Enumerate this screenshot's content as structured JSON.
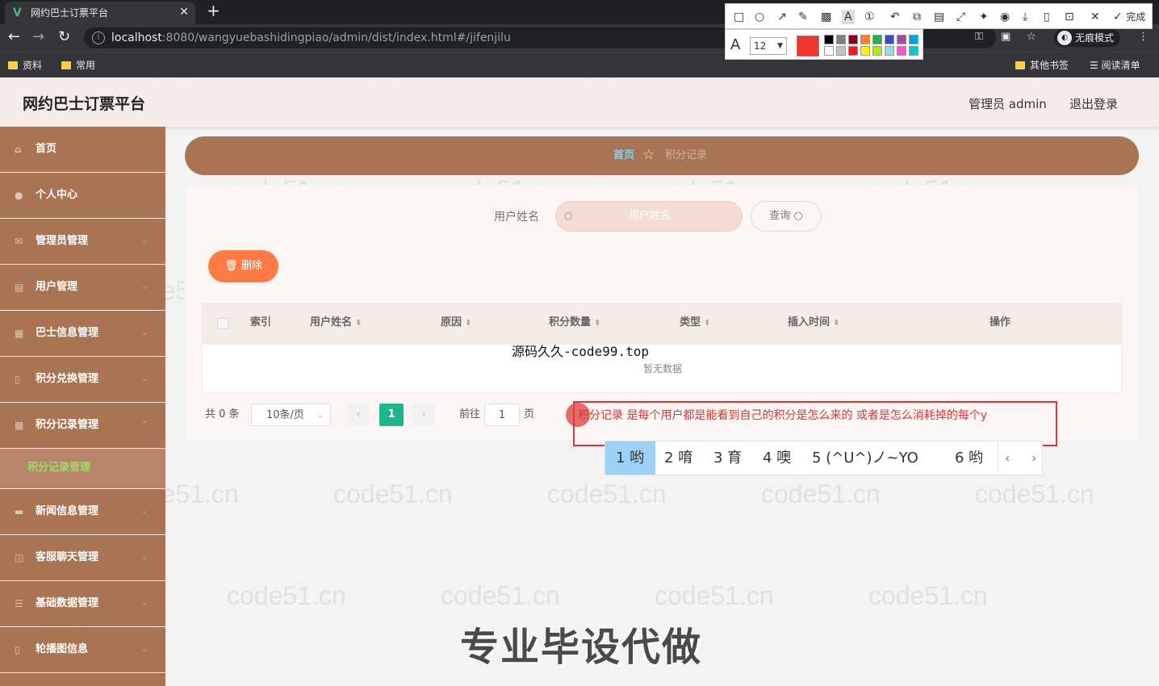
{
  "browser": {
    "tab_title": "网约巴士订票平台",
    "tab_favicon": "V",
    "url_host": "localhost",
    "url_rest": ":8080/wangyuebashidingpiao/admin/dist/index.html#/jifenjilu",
    "incognito_label": "无痕模式",
    "bookmarks": [
      "资料",
      "常用"
    ],
    "other_bookmarks": "其他书签",
    "reading_list": "阅读清单"
  },
  "snip_tool": {
    "done_label": "完成",
    "font_size": "12",
    "current_color": "#f0362a",
    "palette": [
      "#000000",
      "#7f7f7f",
      "#880015",
      "#ff7f27",
      "#22b14c",
      "#3f48cc",
      "#a349a4",
      "#00a2e8",
      "#ffffff",
      "#c3c3c3",
      "#ed1c24",
      "#fff200",
      "#b5e61d",
      "#99d9ea",
      "#ff55cc",
      "#00cccc"
    ]
  },
  "header": {
    "title": "网约巴士订票平台",
    "admin": "管理员 admin",
    "logout": "退出登录"
  },
  "sidebar": {
    "items": [
      {
        "label": "首页"
      },
      {
        "label": "个人中心"
      },
      {
        "label": "管理员管理"
      },
      {
        "label": "用户管理"
      },
      {
        "label": "巴士信息管理"
      },
      {
        "label": "积分兑换管理"
      },
      {
        "label": "积分记录管理"
      },
      {
        "label": "新闻信息管理"
      },
      {
        "label": "客服聊天管理"
      },
      {
        "label": "基础数据管理"
      },
      {
        "label": "轮播图信息"
      }
    ],
    "active_sub": "积分记录管理"
  },
  "breadcrumb": {
    "home": "首页",
    "current": "积分记录"
  },
  "search": {
    "label": "用户姓名",
    "placeholder": "用户姓名",
    "button": "查询"
  },
  "actions": {
    "delete": "删除"
  },
  "table": {
    "columns": [
      "索引",
      "用户姓名",
      "原因",
      "积分数量",
      "类型",
      "插入时间",
      "操作"
    ],
    "empty_text": "暂无数据"
  },
  "pagination": {
    "total": "共 0 条",
    "page_size": "10条/页",
    "current_page": "1",
    "goto_label": "前往",
    "goto_value": "1",
    "unit": "页"
  },
  "annotation": {
    "text": "积分记录 是每个用户都是能看到自己的积分是怎么来的 或者是怎么消耗掉的每个y"
  },
  "ime": {
    "candidates": [
      "1 哟",
      "2 唷",
      "3 育",
      "4 噢",
      "5 (^U^)ノ~YO",
      "6 哟"
    ]
  },
  "watermarks": {
    "site": "code51.cn",
    "code99": "源码久久-code99.top",
    "big": "专业毕设代做"
  }
}
